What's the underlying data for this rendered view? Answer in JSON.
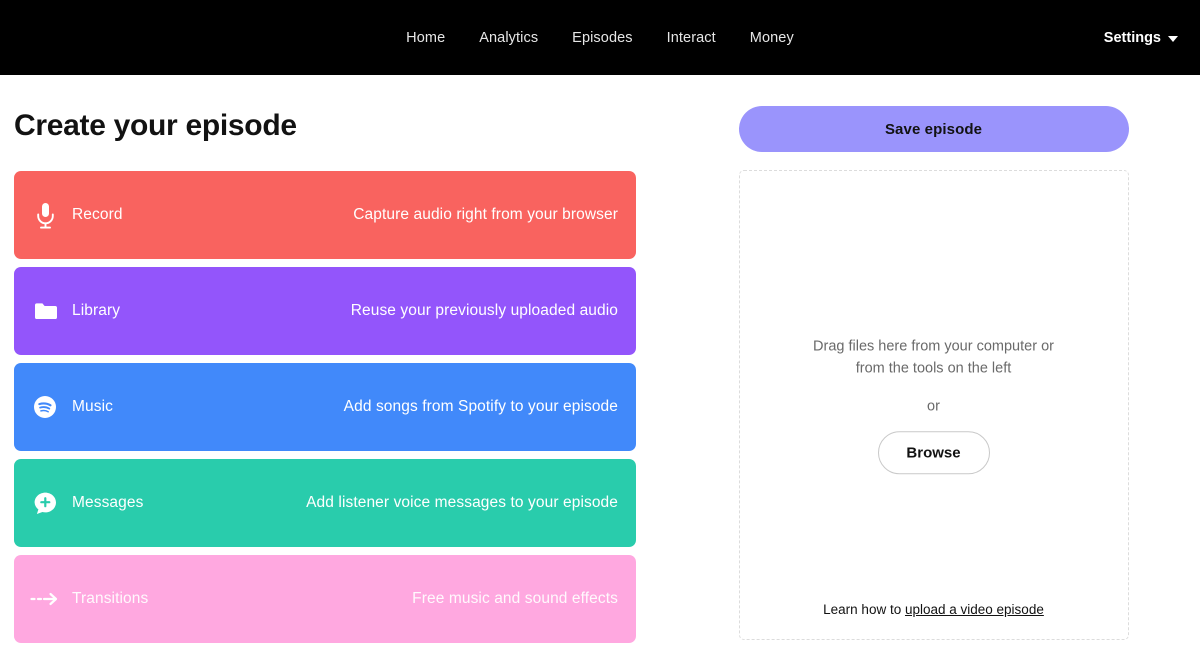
{
  "nav": {
    "links": [
      {
        "label": "Home",
        "name": "nav-link-home"
      },
      {
        "label": "Analytics",
        "name": "nav-link-analytics"
      },
      {
        "label": "Episodes",
        "name": "nav-link-episodes"
      },
      {
        "label": "Interact",
        "name": "nav-link-interact"
      },
      {
        "label": "Money",
        "name": "nav-link-money"
      }
    ],
    "settings_label": "Settings",
    "settings_icon": "chevron-down-icon",
    "background": "#000000"
  },
  "main": {
    "title": "Create your episode",
    "cards": [
      {
        "label": "Record",
        "description": "Capture audio right from your browser",
        "color": "#f9635f",
        "icon": "microphone-icon",
        "name": "tool-card-record"
      },
      {
        "label": "Library",
        "description": "Reuse your previously uploaded audio",
        "color": "#9355fb",
        "icon": "folder-icon",
        "name": "tool-card-library"
      },
      {
        "label": "Music",
        "description": "Add songs from Spotify to your episode",
        "color": "#4189fa",
        "icon": "spotify-icon",
        "name": "tool-card-music"
      },
      {
        "label": "Messages",
        "description": "Add listener voice messages to your episode",
        "color": "#29ccac",
        "icon": "message-plus-icon",
        "name": "tool-card-messages"
      },
      {
        "label": "Transitions",
        "description": "Free music and sound effects",
        "color": "#ffa8e0",
        "icon": "dashed-arrow-icon",
        "name": "tool-card-transitions"
      }
    ]
  },
  "editor": {
    "save_label": "Save episode",
    "save_color": "#9a94fc",
    "dropzone": {
      "instructions": "Drag files here from your computer or from the tools on the left",
      "or_label": "or",
      "browse_label": "Browse",
      "footer_prefix": "Learn how to ",
      "footer_link": "upload a video episode"
    }
  }
}
